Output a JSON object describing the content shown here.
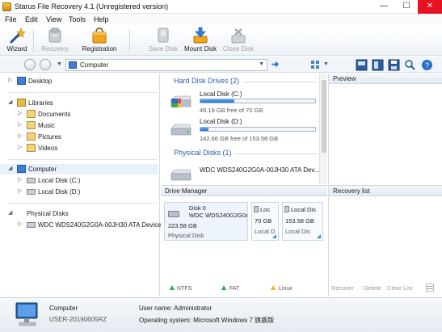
{
  "window": {
    "title": "Starus File Recovery 4.1 (Unregistered version)",
    "minimize": "—",
    "maximize": "☐",
    "close": "✕"
  },
  "menu": [
    "File",
    "Edit",
    "View",
    "Tools",
    "Help"
  ],
  "toolbar": {
    "wizard": "Wizard",
    "recovery": "Recovery",
    "registration": "Registration",
    "save_disk": "Save Disk",
    "mount_disk": "Mount Disk",
    "close_disk": "Close Disk"
  },
  "address": {
    "value": "Computer"
  },
  "tree": {
    "desktop": "Desktop",
    "libraries": "Libraries",
    "documents": "Documents",
    "music": "Music",
    "pictures": "Pictures",
    "videos": "Videos",
    "computer": "Computer",
    "local_c": "Local Disk (C:)",
    "local_d": "Local Disk (D:)",
    "physical_disks": "Physical Disks",
    "physical_disk_name": "WDC WDS240G2G0A-00JH30 ATA Device"
  },
  "disks": {
    "hdd_header": "Hard Disk Drives (2)",
    "physical_header": "Physical Disks (1)",
    "c_name": "Local Disk (C:)",
    "c_free": "49.19 GB free of 70 GB",
    "c_used_fraction": 0.297,
    "d_name": "Local Disk (D:)",
    "d_free": "142.66 GB free of 153.58 GB",
    "d_used_fraction": 0.071,
    "physical_name": "WDC WDS240G2G0A-00JH30 ATA Dev..."
  },
  "preview": {
    "title": "Preview"
  },
  "drive_manager": {
    "title": "Drive Manager",
    "disk_label": "Disk 0",
    "disk_model": "WDC WDS240G2G0A-",
    "disk_size": "223.58 GB",
    "disk_type": "Physical Disk",
    "part1_name": "Loc",
    "part1_size": "70 GB",
    "part1_label": "Local D",
    "part2_name": "Local Dis",
    "part2_size": "153.58 GB",
    "part2_label": "Local Dis",
    "legend_ntfs": "NTFS",
    "legend_fat": "FAT",
    "legend_linux": "Linux"
  },
  "recovery_list": {
    "title": "Recovery list",
    "recover": "Recover",
    "delete": "Delete",
    "clear": "Clear List"
  },
  "status": {
    "name": "Computer",
    "host": "USER-20190605RZ",
    "user_label": "User name: Administrator",
    "os_label": "Operating system: Microsoft Windows 7 旗舰版"
  },
  "colors": {
    "accent": "#1f77d0",
    "section_header": "#2b5ea7",
    "close_button": "#e81123"
  }
}
